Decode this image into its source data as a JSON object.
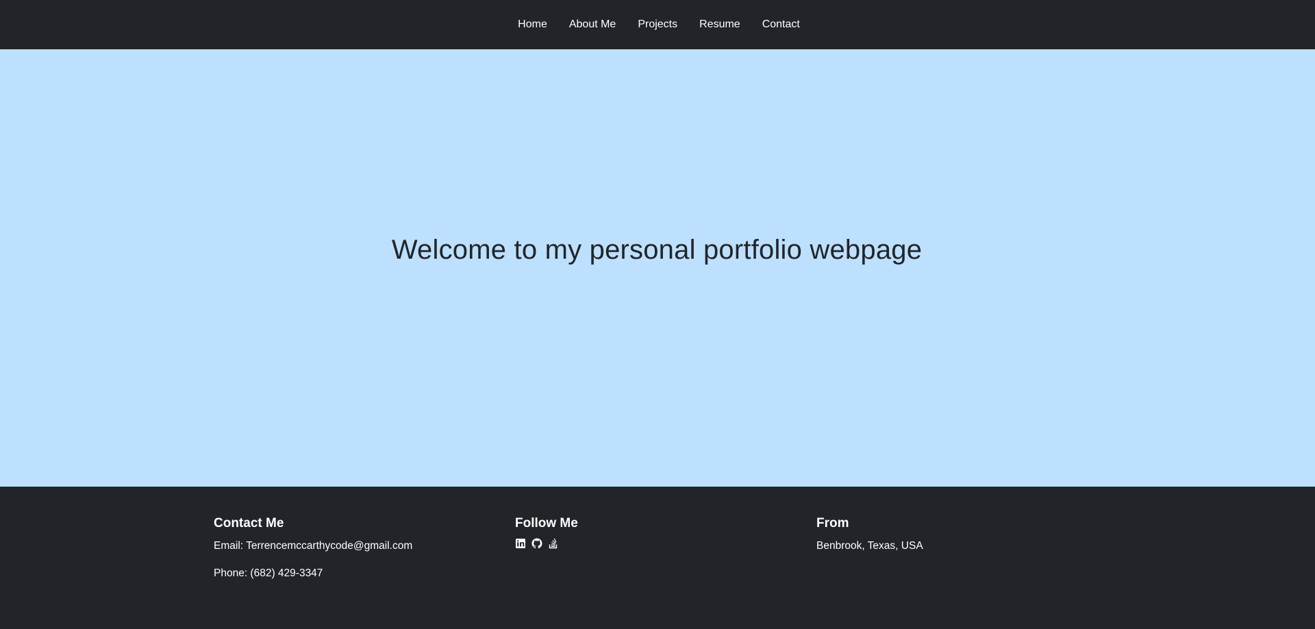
{
  "nav": {
    "items": [
      {
        "label": "Home"
      },
      {
        "label": "About Me"
      },
      {
        "label": "Projects"
      },
      {
        "label": "Resume"
      },
      {
        "label": "Contact"
      }
    ]
  },
  "hero": {
    "title": "Welcome to my personal portfolio webpage"
  },
  "footer": {
    "contact": {
      "heading": "Contact Me",
      "email": "Email: Terrencemccarthycode@gmail.com",
      "phone": "Phone: (682) 429-3347"
    },
    "follow": {
      "heading": "Follow Me",
      "icons": [
        "linkedin-icon",
        "github-icon",
        "stack-overflow-icon"
      ]
    },
    "from": {
      "heading": "From",
      "location": "Benbrook, Texas, USA"
    }
  },
  "colors": {
    "nav_bg": "#212529",
    "hero_bg": "#bde0fe",
    "footer_bg": "#212529",
    "text_light": "#ffffff",
    "text_dark": "#212529"
  }
}
